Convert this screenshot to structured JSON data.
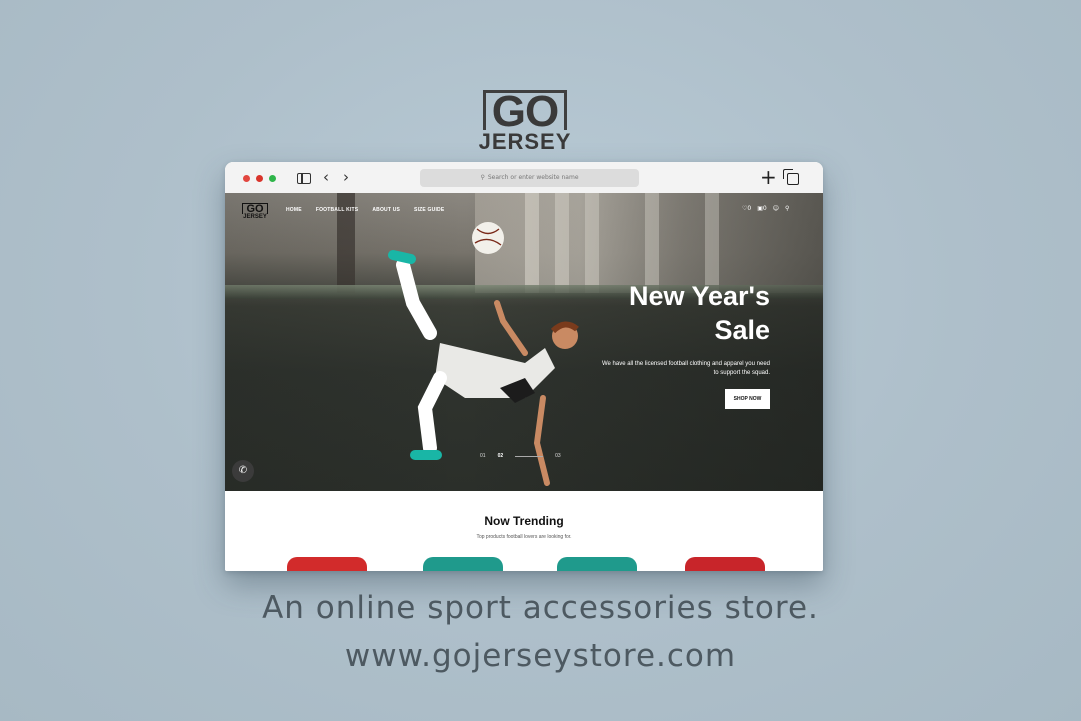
{
  "brand": {
    "line1": "GO",
    "line2": "JERSEY"
  },
  "browser": {
    "address_placeholder": "Search or enter website name",
    "icons": [
      "sidebar-icon",
      "back-icon",
      "forward-icon",
      "search-icon",
      "new-tab-icon",
      "tabs-icon"
    ]
  },
  "site": {
    "logo": {
      "line1": "GO",
      "line2": "JERSEY"
    },
    "nav": [
      "HOME",
      "FOOTBALL KITS",
      "ABOUT US",
      "SIZE GUIDE"
    ],
    "nav_right": {
      "wishlist_count": "0",
      "cart_count": "0"
    },
    "hero": {
      "title_line1": "New Year's",
      "title_line2": "Sale",
      "subtitle_line1": "We have all the licensed football clothing and apparel you need",
      "subtitle_line2": "to support the squad.",
      "cta": "SHOP NOW",
      "slides": [
        "01",
        "02",
        "03"
      ],
      "active_slide": "02"
    },
    "trending": {
      "title": "Now Trending",
      "subtitle": "Top products football lovers are looking for."
    }
  },
  "captions": {
    "line1": "An online sport accessories store.",
    "line2": "www.gojerseystore.com"
  },
  "colors": {
    "background": "#aebfca",
    "caption": "#4d5961",
    "shirt_red": "#d22b2b",
    "shirt_teal": "#1f9a8c"
  }
}
